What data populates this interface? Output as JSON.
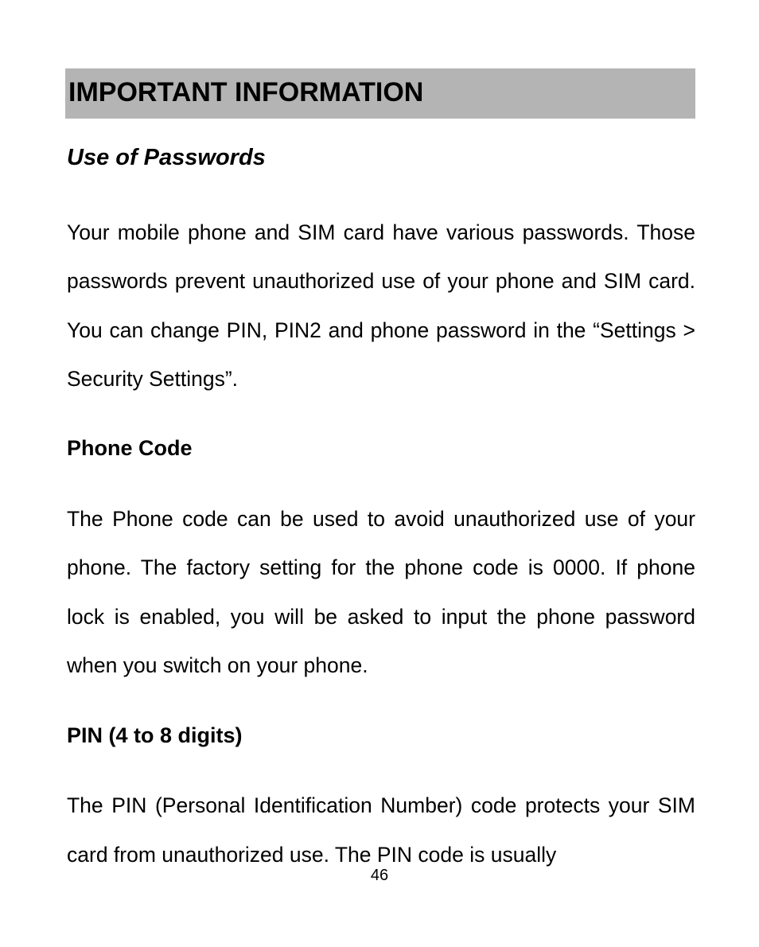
{
  "mainHeading": "IMPORTANT INFORMATION",
  "sectionHeading": "Use of Passwords",
  "paragraph1": "Your mobile phone and SIM card have various passwords. Those passwords prevent unauthorized use of your phone and SIM card. You can change PIN, PIN2 and phone password in the “Settings > Security Settings”.",
  "subHeading1": "Phone Code",
  "paragraph2": "The Phone code can be used to avoid unauthorized use of your phone. The factory setting for the phone code is 0000. If phone lock is enabled, you will be asked to input the phone password when you switch on your phone.",
  "subHeading2": "PIN (4 to 8 digits)",
  "paragraph3": "The PIN (Personal Identification Number) code protects your SIM card from unauthorized use. The PIN code is usually",
  "pageNumber": "46"
}
